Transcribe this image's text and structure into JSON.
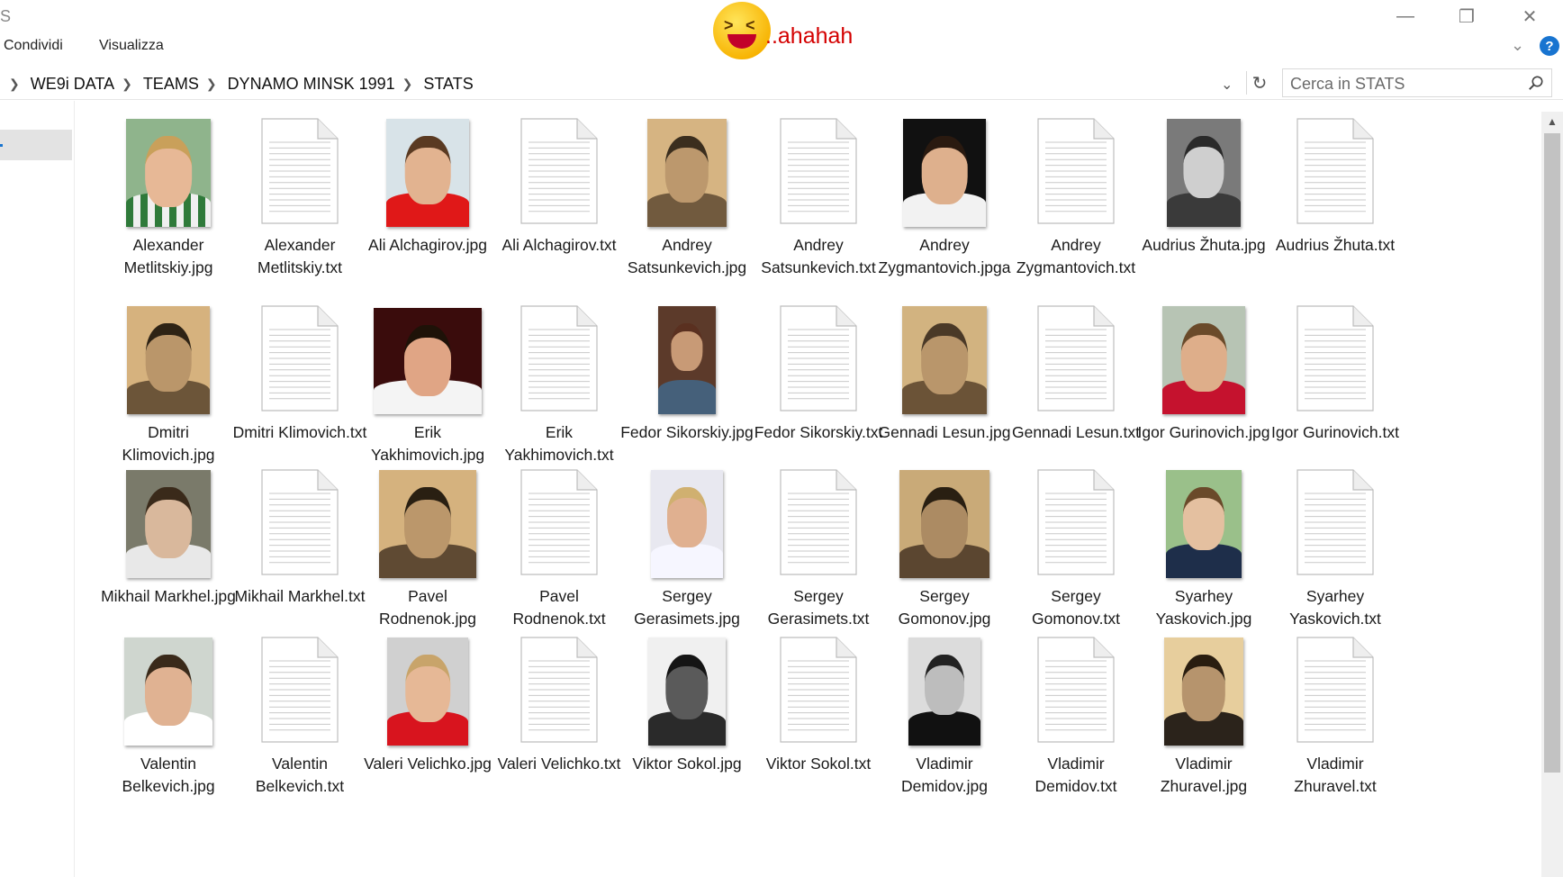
{
  "window": {
    "title_fragment": "S",
    "minimize_glyph": "—",
    "maximize_glyph": "❐",
    "close_glyph": "✕"
  },
  "ribbon": {
    "tabs": [
      "Condividi",
      "Visualizza"
    ],
    "collapse_glyph": "⌄",
    "help_label": "?"
  },
  "overlay": {
    "text": "..ahahah"
  },
  "address": {
    "breadcrumb": [
      "WE9i DATA",
      "TEAMS",
      "DYNAMO MINSK 1991",
      "STATS"
    ],
    "dropdown_glyph": "⌄",
    "refresh_glyph": "↻"
  },
  "search": {
    "placeholder": "Cerca in STATS"
  },
  "scrollbar": {
    "up_glyph": "▲"
  },
  "colors": {
    "accent": "#1874d0",
    "overlay_text": "#d40000",
    "nav_selected": "#e3e3e3"
  },
  "files": [
    {
      "name": "Alexander Metlitskiy.jpg",
      "type": "jpg"
    },
    {
      "name": "Alexander Metlitskiy.txt",
      "type": "txt"
    },
    {
      "name": "Ali Alchagirov.jpg",
      "type": "jpg"
    },
    {
      "name": "Ali Alchagirov.txt",
      "type": "txt"
    },
    {
      "name": "Andrey Satsunkevich.jpg",
      "type": "jpg"
    },
    {
      "name": "Andrey Satsunkevich.txt",
      "type": "txt"
    },
    {
      "name": "Andrey Zygmantovich.jpg​a",
      "type": "jpg"
    },
    {
      "name": "Andrey Zygmantovich.txt",
      "type": "txt"
    },
    {
      "name": "Audrius Žhuta.jpg",
      "type": "jpg"
    },
    {
      "name": "Audrius Žhuta.txt",
      "type": "txt"
    },
    {
      "name": "Dmitri Klimovich.jpg",
      "type": "jpg"
    },
    {
      "name": "Dmitri Klimovich.txt",
      "type": "txt"
    },
    {
      "name": "Erik Yakhimovich.jpg",
      "type": "jpg"
    },
    {
      "name": "Erik Yakhimovich.txt",
      "type": "txt"
    },
    {
      "name": "Fedor Sikorskiy.jpg",
      "type": "jpg"
    },
    {
      "name": "Fedor Sikorskiy.txt",
      "type": "txt"
    },
    {
      "name": "Gennadi Lesun.jpg",
      "type": "jpg"
    },
    {
      "name": "Gennadi Lesun.txt",
      "type": "txt"
    },
    {
      "name": "Igor Gurinovich.jpg",
      "type": "jpg"
    },
    {
      "name": "Igor Gurinovich.txt",
      "type": "txt"
    },
    {
      "name": "Mikhail Markhel.jpg",
      "type": "jpg"
    },
    {
      "name": "Mikhail Markhel.txt",
      "type": "txt"
    },
    {
      "name": "Pavel Rodnenok.jpg",
      "type": "jpg"
    },
    {
      "name": "Pavel Rodnenok.txt",
      "type": "txt"
    },
    {
      "name": "Sergey Gerasimets.jpg",
      "type": "jpg"
    },
    {
      "name": "Sergey Gerasimets.txt",
      "type": "txt"
    },
    {
      "name": "Sergey Gomonov.jpg",
      "type": "jpg"
    },
    {
      "name": "Sergey Gomonov.txt",
      "type": "txt"
    },
    {
      "name": "Syarhey Yaskovich.jpg",
      "type": "jpg"
    },
    {
      "name": "Syarhey Yaskovich.txt",
      "type": "txt"
    },
    {
      "name": "Valentin Belkevich.jpg",
      "type": "jpg"
    },
    {
      "name": "Valentin Belkevich.txt",
      "type": "txt"
    },
    {
      "name": "Valeri Velichko.jpg",
      "type": "jpg"
    },
    {
      "name": "Valeri Velichko.txt",
      "type": "txt"
    },
    {
      "name": "Viktor Sokol.jpg",
      "type": "jpg"
    },
    {
      "name": "Viktor Sokol.txt",
      "type": "txt"
    },
    {
      "name": "Vladimir Demidov.jpg",
      "type": "jpg"
    },
    {
      "name": "Vladimir Demidov.txt",
      "type": "txt"
    },
    {
      "name": "Vladimir Zhuravel.jpg",
      "type": "jpg"
    },
    {
      "name": "Vladimir Zhuravel.txt",
      "type": "txt"
    }
  ]
}
